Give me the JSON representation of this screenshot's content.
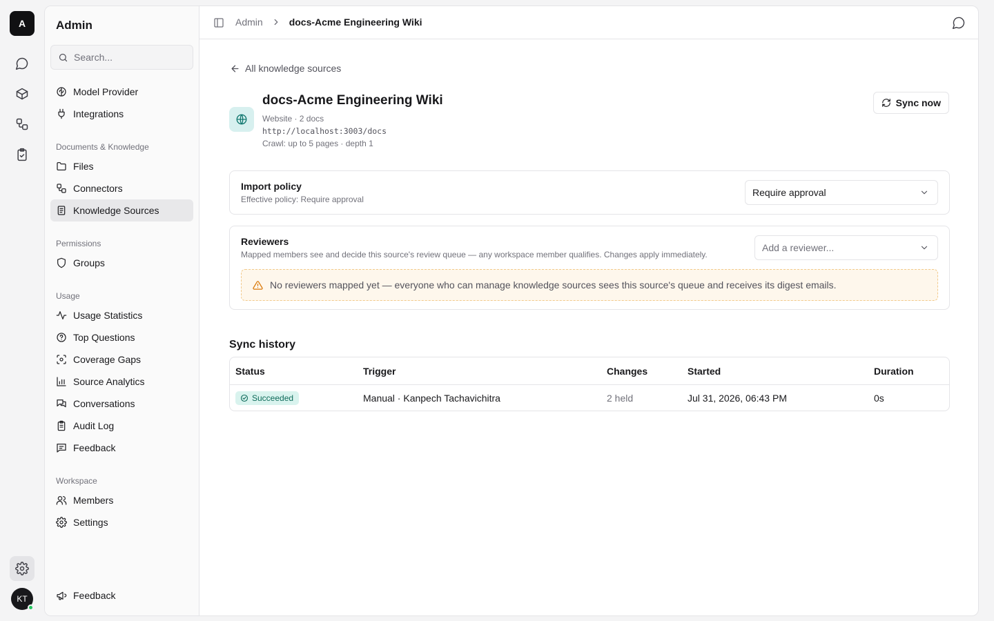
{
  "rail": {
    "logo_letter": "A",
    "items": [
      "chat-icon",
      "box-icon",
      "workflow-icon",
      "clipboard-check-icon"
    ],
    "settings_icon": "gear-icon",
    "avatar_initials": "KT"
  },
  "sidebar": {
    "title": "Admin",
    "search_placeholder": "Search...",
    "top_items": [
      {
        "label": "Model Provider",
        "icon": "brain-icon"
      },
      {
        "label": "Integrations",
        "icon": "plug-icon"
      }
    ],
    "sections": [
      {
        "label": "Documents & Knowledge",
        "items": [
          {
            "label": "Files",
            "icon": "folder-icon"
          },
          {
            "label": "Connectors",
            "icon": "connector-icon"
          },
          {
            "label": "Knowledge Sources",
            "icon": "book-icon",
            "active": true
          }
        ]
      },
      {
        "label": "Permissions",
        "items": [
          {
            "label": "Groups",
            "icon": "shield-icon"
          }
        ]
      },
      {
        "label": "Usage",
        "items": [
          {
            "label": "Usage Statistics",
            "icon": "activity-icon"
          },
          {
            "label": "Top Questions",
            "icon": "question-icon"
          },
          {
            "label": "Coverage Gaps",
            "icon": "scan-icon"
          },
          {
            "label": "Source Analytics",
            "icon": "bar-chart-icon"
          },
          {
            "label": "Conversations",
            "icon": "messages-icon"
          },
          {
            "label": "Audit Log",
            "icon": "clipboard-icon"
          },
          {
            "label": "Feedback",
            "icon": "message-square-icon"
          }
        ]
      },
      {
        "label": "Workspace",
        "items": [
          {
            "label": "Members",
            "icon": "users-icon"
          },
          {
            "label": "Settings",
            "icon": "gear-icon"
          }
        ]
      }
    ],
    "footer_label": "Feedback"
  },
  "header": {
    "breadcrumb_root": "Admin",
    "breadcrumb_sep": "›",
    "breadcrumb_current": "docs-Acme Engineering Wiki"
  },
  "page": {
    "back_label": "All knowledge sources",
    "source_title": "docs-Acme Engineering Wiki",
    "source_type_line": "Website · 2 docs",
    "source_url": "http://localhost:3003/docs",
    "crawl_line": "Crawl: up to 5 pages · depth 1",
    "sync_button": "Sync now"
  },
  "import_policy": {
    "title": "Import policy",
    "subtitle": "Effective policy: Require approval",
    "selected": "Require approval"
  },
  "reviewers": {
    "title": "Reviewers",
    "subtitle": "Mapped members see and decide this source's review queue — any workspace member qualifies. Changes apply immediately.",
    "placeholder": "Add a reviewer...",
    "warning": "No reviewers mapped yet — everyone who can manage knowledge sources sees this source's queue and receives its digest emails."
  },
  "sync_history": {
    "title": "Sync history",
    "columns": [
      "Status",
      "Trigger",
      "Changes",
      "Started",
      "Duration"
    ],
    "rows": [
      {
        "status": "Succeeded",
        "trigger": "Manual · Kanpech Tachavichitra",
        "changes": "2 held",
        "started": "Jul 31, 2026, 06:43 PM",
        "duration": "0s"
      }
    ]
  },
  "colors": {
    "accent": "#0f766e",
    "badge_bg": "#d9f3ee",
    "warning_bg": "#fef7ec",
    "warning_border": "#f2c98a"
  }
}
